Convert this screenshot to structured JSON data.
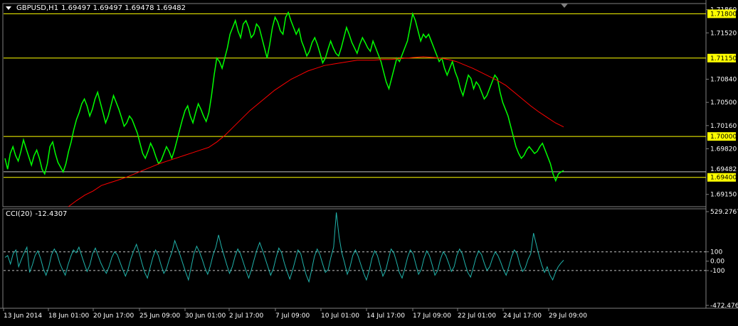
{
  "header": {
    "symbol": "GBPUSD,H1",
    "ohlc": "1.69497 1.69497 1.69478 1.69482"
  },
  "indicator": {
    "name": "CCI(20)",
    "value": "-12.4307"
  },
  "colors": {
    "background": "#000000",
    "price": "#00ff00",
    "ma": "#ff0000",
    "cci": "#20b2aa",
    "level_line": "#ffff00",
    "grid_text": "#ffffff"
  },
  "chart_data": [
    {
      "type": "line",
      "title": "GBPUSD,H1",
      "ylim": [
        1.6897,
        1.7195
      ],
      "y_ticks": [
        "1.71860",
        "1.71520",
        "1.70840",
        "1.70500",
        "1.70160",
        "1.69820",
        "1.69150"
      ],
      "level_labels": [
        "1.71800",
        "1.71150",
        "1.70000",
        "1.69400"
      ],
      "levels": [
        1.718,
        1.7115,
        1.7,
        1.694
      ],
      "current_price_label": "1.69482",
      "current_price": 1.69482,
      "x_labels": [
        "13 Jun 2014",
        "18 Jun 01:00",
        "20 Jun 17:00",
        "25 Jun 09:00",
        "30 Jun 01:00",
        "2 Jul 17:00",
        "7 Jul 09:00",
        "10 Jul 01:00",
        "14 Jul 17:00",
        "17 Jul 09:00",
        "22 Jul 01:00",
        "24 Jul 17:00",
        "29 Jul 09:00"
      ],
      "series": [
        {
          "values": [
            1.6968,
            1.6952,
            1.6975,
            1.6985,
            1.6972,
            1.6964,
            1.6978,
            1.6995,
            1.6982,
            1.697,
            1.6958,
            1.6972,
            1.698,
            1.6968,
            1.6952,
            1.6945,
            1.696,
            1.6985,
            1.6992,
            1.6975,
            1.6962,
            1.6955,
            1.6948,
            1.696,
            1.6978,
            1.6992,
            1.701,
            1.7025,
            1.7035,
            1.7048,
            1.7055,
            1.7045,
            1.703,
            1.704,
            1.7055,
            1.7065,
            1.705,
            1.7035,
            1.702,
            1.703,
            1.7045,
            1.706,
            1.705,
            1.704,
            1.7028,
            1.7015,
            1.702,
            1.703,
            1.7025,
            1.7015,
            1.7005,
            1.699,
            1.6975,
            1.6968,
            1.6978,
            1.699,
            1.6982,
            1.697,
            1.696,
            1.6965,
            1.6975,
            1.6985,
            1.6978,
            1.6968,
            1.698,
            1.6995,
            1.701,
            1.7025,
            1.7038,
            1.7045,
            1.703,
            1.702,
            1.7035,
            1.7048,
            1.704,
            1.703,
            1.7022,
            1.7035,
            1.706,
            1.709,
            1.7115,
            1.711,
            1.71,
            1.7115,
            1.713,
            1.715,
            1.716,
            1.717,
            1.7155,
            1.7145,
            1.7165,
            1.717,
            1.716,
            1.7145,
            1.715,
            1.7165,
            1.716,
            1.7145,
            1.713,
            1.7115,
            1.7135,
            1.716,
            1.7175,
            1.7168,
            1.7155,
            1.715,
            1.7175,
            1.7182,
            1.717,
            1.716,
            1.715,
            1.7158,
            1.714,
            1.713,
            1.7118,
            1.7125,
            1.7138,
            1.7145,
            1.7135,
            1.7122,
            1.7108,
            1.7115,
            1.7128,
            1.714,
            1.713,
            1.7122,
            1.7118,
            1.713,
            1.7145,
            1.716,
            1.715,
            1.7138,
            1.713,
            1.7122,
            1.7135,
            1.7145,
            1.7138,
            1.713,
            1.7125,
            1.714,
            1.713,
            1.712,
            1.711,
            1.7095,
            1.708,
            1.707,
            1.7085,
            1.71,
            1.7115,
            1.711,
            1.712,
            1.713,
            1.714,
            1.716,
            1.718,
            1.717,
            1.7155,
            1.714,
            1.715,
            1.7145,
            1.715,
            1.714,
            1.713,
            1.712,
            1.711,
            1.7115,
            1.71,
            1.709,
            1.71,
            1.711,
            1.7095,
            1.7085,
            1.707,
            1.706,
            1.7075,
            1.709,
            1.7085,
            1.707,
            1.708,
            1.7075,
            1.7065,
            1.7055,
            1.706,
            1.707,
            1.708,
            1.709,
            1.7085,
            1.7065,
            1.705,
            1.704,
            1.703,
            1.7015,
            1.7,
            1.6985,
            1.6975,
            1.6968,
            1.6972,
            1.698,
            1.6985,
            1.698,
            1.6975,
            1.6978,
            1.6985,
            1.699,
            1.698,
            1.697,
            1.696,
            1.6945,
            1.6935,
            1.6945,
            1.6948,
            1.695
          ]
        },
        {
          "values": [
            1.6895,
            1.6906,
            1.6914,
            1.692,
            1.6928,
            1.6932,
            1.6936,
            1.694,
            1.6945,
            1.695,
            1.6955,
            1.696,
            1.6964,
            1.6968,
            1.6972,
            1.6976,
            1.698,
            1.6984,
            1.6992,
            1.7002,
            1.7014,
            1.7026,
            1.7038,
            1.7048,
            1.7058,
            1.7068,
            1.7076,
            1.7084,
            1.709,
            1.7096,
            1.71,
            1.7104,
            1.7106,
            1.7108,
            1.711,
            1.7112,
            1.7112,
            1.7112,
            1.7113,
            1.7113,
            1.7114,
            1.7115,
            1.7116,
            1.7117,
            1.7116,
            1.7115,
            1.7113,
            1.711,
            1.7105,
            1.71,
            1.7094,
            1.7088,
            1.7082,
            1.7075,
            1.7065,
            1.7055,
            1.7045,
            1.7036,
            1.7028,
            1.702,
            1.7014
          ]
        }
      ]
    },
    {
      "type": "line",
      "title": "CCI(20) -12.4307",
      "ylim": [
        -472.476,
        529.2767
      ],
      "y_ticks": [
        "529.2767",
        "100",
        "0.00",
        "-100",
        "-472.476"
      ],
      "levels": [
        100,
        -100
      ],
      "series": [
        {
          "values": [
            40,
            60,
            -30,
            80,
            120,
            -60,
            20,
            90,
            150,
            -120,
            -40,
            60,
            110,
            30,
            -80,
            -150,
            -60,
            70,
            130,
            80,
            -20,
            -90,
            -150,
            -40,
            50,
            120,
            90,
            150,
            60,
            -30,
            -110,
            -40,
            80,
            140,
            60,
            -20,
            -80,
            -130,
            -60,
            40,
            100,
            70,
            -10,
            -90,
            -160,
            -80,
            30,
            110,
            180,
            90,
            -20,
            -120,
            -180,
            -70,
            40,
            120,
            60,
            -40,
            -130,
            -80,
            20,
            100,
            220,
            140,
            60,
            -30,
            -120,
            -200,
            -60,
            80,
            160,
            100,
            20,
            -70,
            -140,
            -50,
            70,
            150,
            280,
            160,
            60,
            -40,
            -130,
            -60,
            50,
            130,
            80,
            -10,
            -100,
            -180,
            -90,
            20,
            120,
            200,
            120,
            30,
            -60,
            -150,
            -80,
            40,
            140,
            90,
            -20,
            -110,
            -190,
            -100,
            10,
            120,
            80,
            -40,
            -150,
            -220,
            -90,
            50,
            130,
            70,
            -30,
            -120,
            -90,
            40,
            150,
            520,
            260,
            90,
            -20,
            -140,
            -60,
            60,
            120,
            50,
            -40,
            -130,
            -200,
            -100,
            30,
            110,
            60,
            -50,
            -160,
            -100,
            20,
            130,
            90,
            -10,
            -120,
            -180,
            -80,
            40,
            120,
            80,
            -30,
            -140,
            -90,
            30,
            110,
            60,
            -40,
            -150,
            -100,
            20,
            100,
            60,
            -20,
            -110,
            -60,
            60,
            130,
            80,
            -30,
            -120,
            -170,
            -70,
            40,
            110,
            70,
            -20,
            -100,
            -60,
            30,
            100,
            60,
            -10,
            -90,
            -150,
            -60,
            50,
            120,
            80,
            -30,
            -110,
            -70,
            20,
            80,
            300,
            180,
            60,
            -40,
            -120,
            -60,
            -150,
            -200,
            -120,
            -60,
            -20,
            10
          ]
        }
      ]
    }
  ]
}
